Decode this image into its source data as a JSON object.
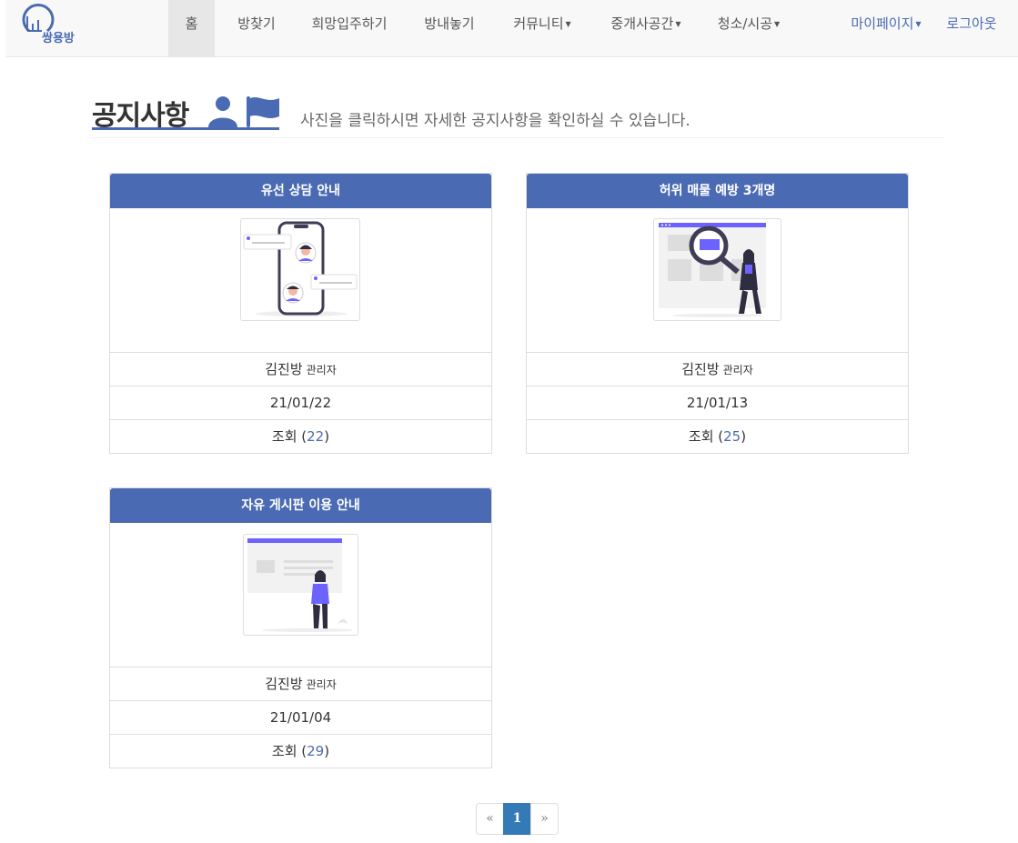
{
  "header": {
    "logo_text": "쌍용방",
    "nav": [
      {
        "label": "홈",
        "active": true
      },
      {
        "label": "방찾기"
      },
      {
        "label": "희망입주하기"
      },
      {
        "label": "방내놓기"
      },
      {
        "label": "커뮤니티",
        "dropdown": true
      },
      {
        "label": "중개사공간",
        "dropdown": true
      },
      {
        "label": "청소/시공",
        "dropdown": true
      }
    ],
    "right": [
      {
        "label": "마이페이지",
        "dropdown": true
      },
      {
        "label": "로그아웃"
      }
    ]
  },
  "page": {
    "title": "공지사항",
    "subtitle": "사진을 클릭하시면 자세한 공지사항을 확인하실 수 있습니다.",
    "title_icons": [
      "user-icon",
      "flag-icon"
    ]
  },
  "notices": [
    {
      "title": "유선 상담 안내",
      "author": "김진방",
      "role": "관리자",
      "date": "21/01/22",
      "views_label": "조회",
      "views": "22",
      "image": "phone-chat-illustration"
    },
    {
      "title": "허위 매물 예방 3개명",
      "author": "김진방",
      "role": "관리자",
      "date": "21/01/13",
      "views_label": "조회",
      "views": "25",
      "image": "magnifier-search-illustration"
    },
    {
      "title": "자유 게시판 이용 안내",
      "author": "김진방",
      "role": "관리자",
      "date": "21/01/04",
      "views_label": "조회",
      "views": "29",
      "image": "board-person-illustration"
    }
  ],
  "pagination": {
    "prev": "«",
    "current": "1",
    "next": "»"
  },
  "colors": {
    "accent": "#4a6bb3",
    "active_page": "#337ab7",
    "illustration": "#6c63ff"
  }
}
